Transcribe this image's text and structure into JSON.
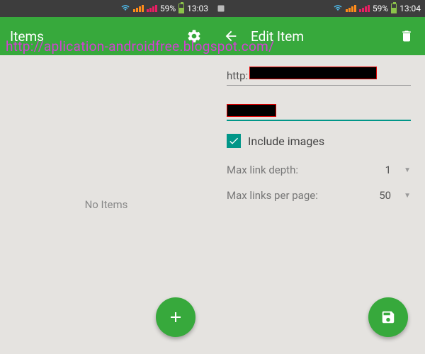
{
  "watermark": "http://aplication-androidfree.blogspot.com/",
  "left": {
    "status": {
      "battery": "59%",
      "time": "13:03"
    },
    "appbar": {
      "title": "Items"
    },
    "empty_text": "No Items"
  },
  "right": {
    "status": {
      "battery": "59%",
      "time": "13:04"
    },
    "appbar": {
      "title": "Edit Item"
    },
    "form": {
      "url_prefix": "http:",
      "include_images_label": "Include images",
      "include_images_checked": true,
      "max_depth_label": "Max link depth:",
      "max_depth_value": "1",
      "max_links_label": "Max links per page:",
      "max_links_value": "50"
    }
  }
}
